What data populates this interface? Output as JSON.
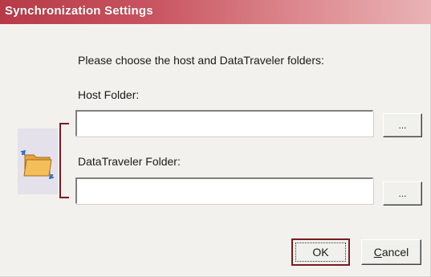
{
  "dialog": {
    "title": "Synchronization Settings",
    "instruction": "Please choose the host and DataTraveler folders:",
    "host_folder": {
      "label": "Host Folder:",
      "value": "",
      "browse_label": "..."
    },
    "datatraveler_folder": {
      "label": "DataTraveler Folder:",
      "value": "",
      "browse_label": "..."
    },
    "buttons": {
      "ok": "OK",
      "cancel_prefix": "C",
      "cancel_rest": "ancel"
    },
    "icons": {
      "sync": "folder-sync-icon"
    },
    "colors": {
      "title_gradient_start": "#b73a47",
      "title_gradient_end": "#e9b3b6",
      "accent": "#7a1c22",
      "background": "#f2f1ee"
    }
  }
}
